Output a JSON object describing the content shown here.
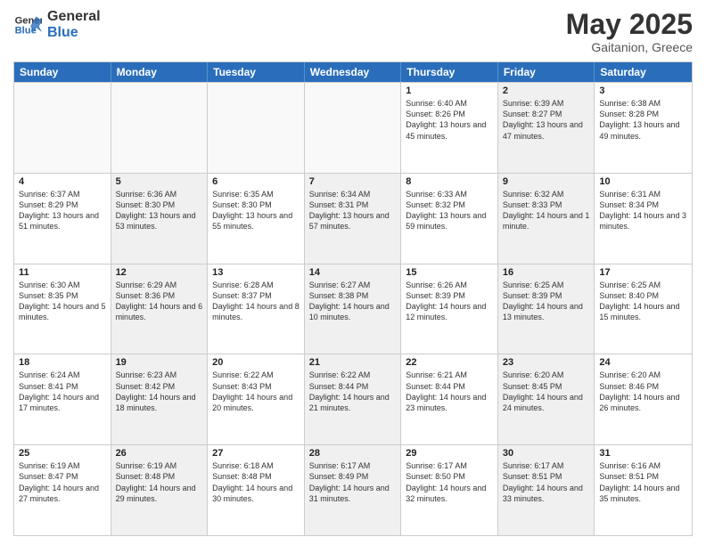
{
  "header": {
    "logo_line1": "General",
    "logo_line2": "Blue",
    "title": "May 2025",
    "subtitle": "Gaitanion, Greece"
  },
  "weekdays": [
    "Sunday",
    "Monday",
    "Tuesday",
    "Wednesday",
    "Thursday",
    "Friday",
    "Saturday"
  ],
  "rows": [
    [
      {
        "day": "",
        "info": "",
        "shaded": false,
        "empty": true
      },
      {
        "day": "",
        "info": "",
        "shaded": false,
        "empty": true
      },
      {
        "day": "",
        "info": "",
        "shaded": false,
        "empty": true
      },
      {
        "day": "",
        "info": "",
        "shaded": false,
        "empty": true
      },
      {
        "day": "1",
        "info": "Sunrise: 6:40 AM\nSunset: 8:26 PM\nDaylight: 13 hours\nand 45 minutes.",
        "shaded": false,
        "empty": false
      },
      {
        "day": "2",
        "info": "Sunrise: 6:39 AM\nSunset: 8:27 PM\nDaylight: 13 hours\nand 47 minutes.",
        "shaded": true,
        "empty": false
      },
      {
        "day": "3",
        "info": "Sunrise: 6:38 AM\nSunset: 8:28 PM\nDaylight: 13 hours\nand 49 minutes.",
        "shaded": false,
        "empty": false
      }
    ],
    [
      {
        "day": "4",
        "info": "Sunrise: 6:37 AM\nSunset: 8:29 PM\nDaylight: 13 hours\nand 51 minutes.",
        "shaded": false,
        "empty": false
      },
      {
        "day": "5",
        "info": "Sunrise: 6:36 AM\nSunset: 8:30 PM\nDaylight: 13 hours\nand 53 minutes.",
        "shaded": true,
        "empty": false
      },
      {
        "day": "6",
        "info": "Sunrise: 6:35 AM\nSunset: 8:30 PM\nDaylight: 13 hours\nand 55 minutes.",
        "shaded": false,
        "empty": false
      },
      {
        "day": "7",
        "info": "Sunrise: 6:34 AM\nSunset: 8:31 PM\nDaylight: 13 hours\nand 57 minutes.",
        "shaded": true,
        "empty": false
      },
      {
        "day": "8",
        "info": "Sunrise: 6:33 AM\nSunset: 8:32 PM\nDaylight: 13 hours\nand 59 minutes.",
        "shaded": false,
        "empty": false
      },
      {
        "day": "9",
        "info": "Sunrise: 6:32 AM\nSunset: 8:33 PM\nDaylight: 14 hours\nand 1 minute.",
        "shaded": true,
        "empty": false
      },
      {
        "day": "10",
        "info": "Sunrise: 6:31 AM\nSunset: 8:34 PM\nDaylight: 14 hours\nand 3 minutes.",
        "shaded": false,
        "empty": false
      }
    ],
    [
      {
        "day": "11",
        "info": "Sunrise: 6:30 AM\nSunset: 8:35 PM\nDaylight: 14 hours\nand 5 minutes.",
        "shaded": false,
        "empty": false
      },
      {
        "day": "12",
        "info": "Sunrise: 6:29 AM\nSunset: 8:36 PM\nDaylight: 14 hours\nand 6 minutes.",
        "shaded": true,
        "empty": false
      },
      {
        "day": "13",
        "info": "Sunrise: 6:28 AM\nSunset: 8:37 PM\nDaylight: 14 hours\nand 8 minutes.",
        "shaded": false,
        "empty": false
      },
      {
        "day": "14",
        "info": "Sunrise: 6:27 AM\nSunset: 8:38 PM\nDaylight: 14 hours\nand 10 minutes.",
        "shaded": true,
        "empty": false
      },
      {
        "day": "15",
        "info": "Sunrise: 6:26 AM\nSunset: 8:39 PM\nDaylight: 14 hours\nand 12 minutes.",
        "shaded": false,
        "empty": false
      },
      {
        "day": "16",
        "info": "Sunrise: 6:25 AM\nSunset: 8:39 PM\nDaylight: 14 hours\nand 13 minutes.",
        "shaded": true,
        "empty": false
      },
      {
        "day": "17",
        "info": "Sunrise: 6:25 AM\nSunset: 8:40 PM\nDaylight: 14 hours\nand 15 minutes.",
        "shaded": false,
        "empty": false
      }
    ],
    [
      {
        "day": "18",
        "info": "Sunrise: 6:24 AM\nSunset: 8:41 PM\nDaylight: 14 hours\nand 17 minutes.",
        "shaded": false,
        "empty": false
      },
      {
        "day": "19",
        "info": "Sunrise: 6:23 AM\nSunset: 8:42 PM\nDaylight: 14 hours\nand 18 minutes.",
        "shaded": true,
        "empty": false
      },
      {
        "day": "20",
        "info": "Sunrise: 6:22 AM\nSunset: 8:43 PM\nDaylight: 14 hours\nand 20 minutes.",
        "shaded": false,
        "empty": false
      },
      {
        "day": "21",
        "info": "Sunrise: 6:22 AM\nSunset: 8:44 PM\nDaylight: 14 hours\nand 21 minutes.",
        "shaded": true,
        "empty": false
      },
      {
        "day": "22",
        "info": "Sunrise: 6:21 AM\nSunset: 8:44 PM\nDaylight: 14 hours\nand 23 minutes.",
        "shaded": false,
        "empty": false
      },
      {
        "day": "23",
        "info": "Sunrise: 6:20 AM\nSunset: 8:45 PM\nDaylight: 14 hours\nand 24 minutes.",
        "shaded": true,
        "empty": false
      },
      {
        "day": "24",
        "info": "Sunrise: 6:20 AM\nSunset: 8:46 PM\nDaylight: 14 hours\nand 26 minutes.",
        "shaded": false,
        "empty": false
      }
    ],
    [
      {
        "day": "25",
        "info": "Sunrise: 6:19 AM\nSunset: 8:47 PM\nDaylight: 14 hours\nand 27 minutes.",
        "shaded": false,
        "empty": false
      },
      {
        "day": "26",
        "info": "Sunrise: 6:19 AM\nSunset: 8:48 PM\nDaylight: 14 hours\nand 29 minutes.",
        "shaded": true,
        "empty": false
      },
      {
        "day": "27",
        "info": "Sunrise: 6:18 AM\nSunset: 8:48 PM\nDaylight: 14 hours\nand 30 minutes.",
        "shaded": false,
        "empty": false
      },
      {
        "day": "28",
        "info": "Sunrise: 6:17 AM\nSunset: 8:49 PM\nDaylight: 14 hours\nand 31 minutes.",
        "shaded": true,
        "empty": false
      },
      {
        "day": "29",
        "info": "Sunrise: 6:17 AM\nSunset: 8:50 PM\nDaylight: 14 hours\nand 32 minutes.",
        "shaded": false,
        "empty": false
      },
      {
        "day": "30",
        "info": "Sunrise: 6:17 AM\nSunset: 8:51 PM\nDaylight: 14 hours\nand 33 minutes.",
        "shaded": true,
        "empty": false
      },
      {
        "day": "31",
        "info": "Sunrise: 6:16 AM\nSunset: 8:51 PM\nDaylight: 14 hours\nand 35 minutes.",
        "shaded": false,
        "empty": false
      }
    ]
  ]
}
